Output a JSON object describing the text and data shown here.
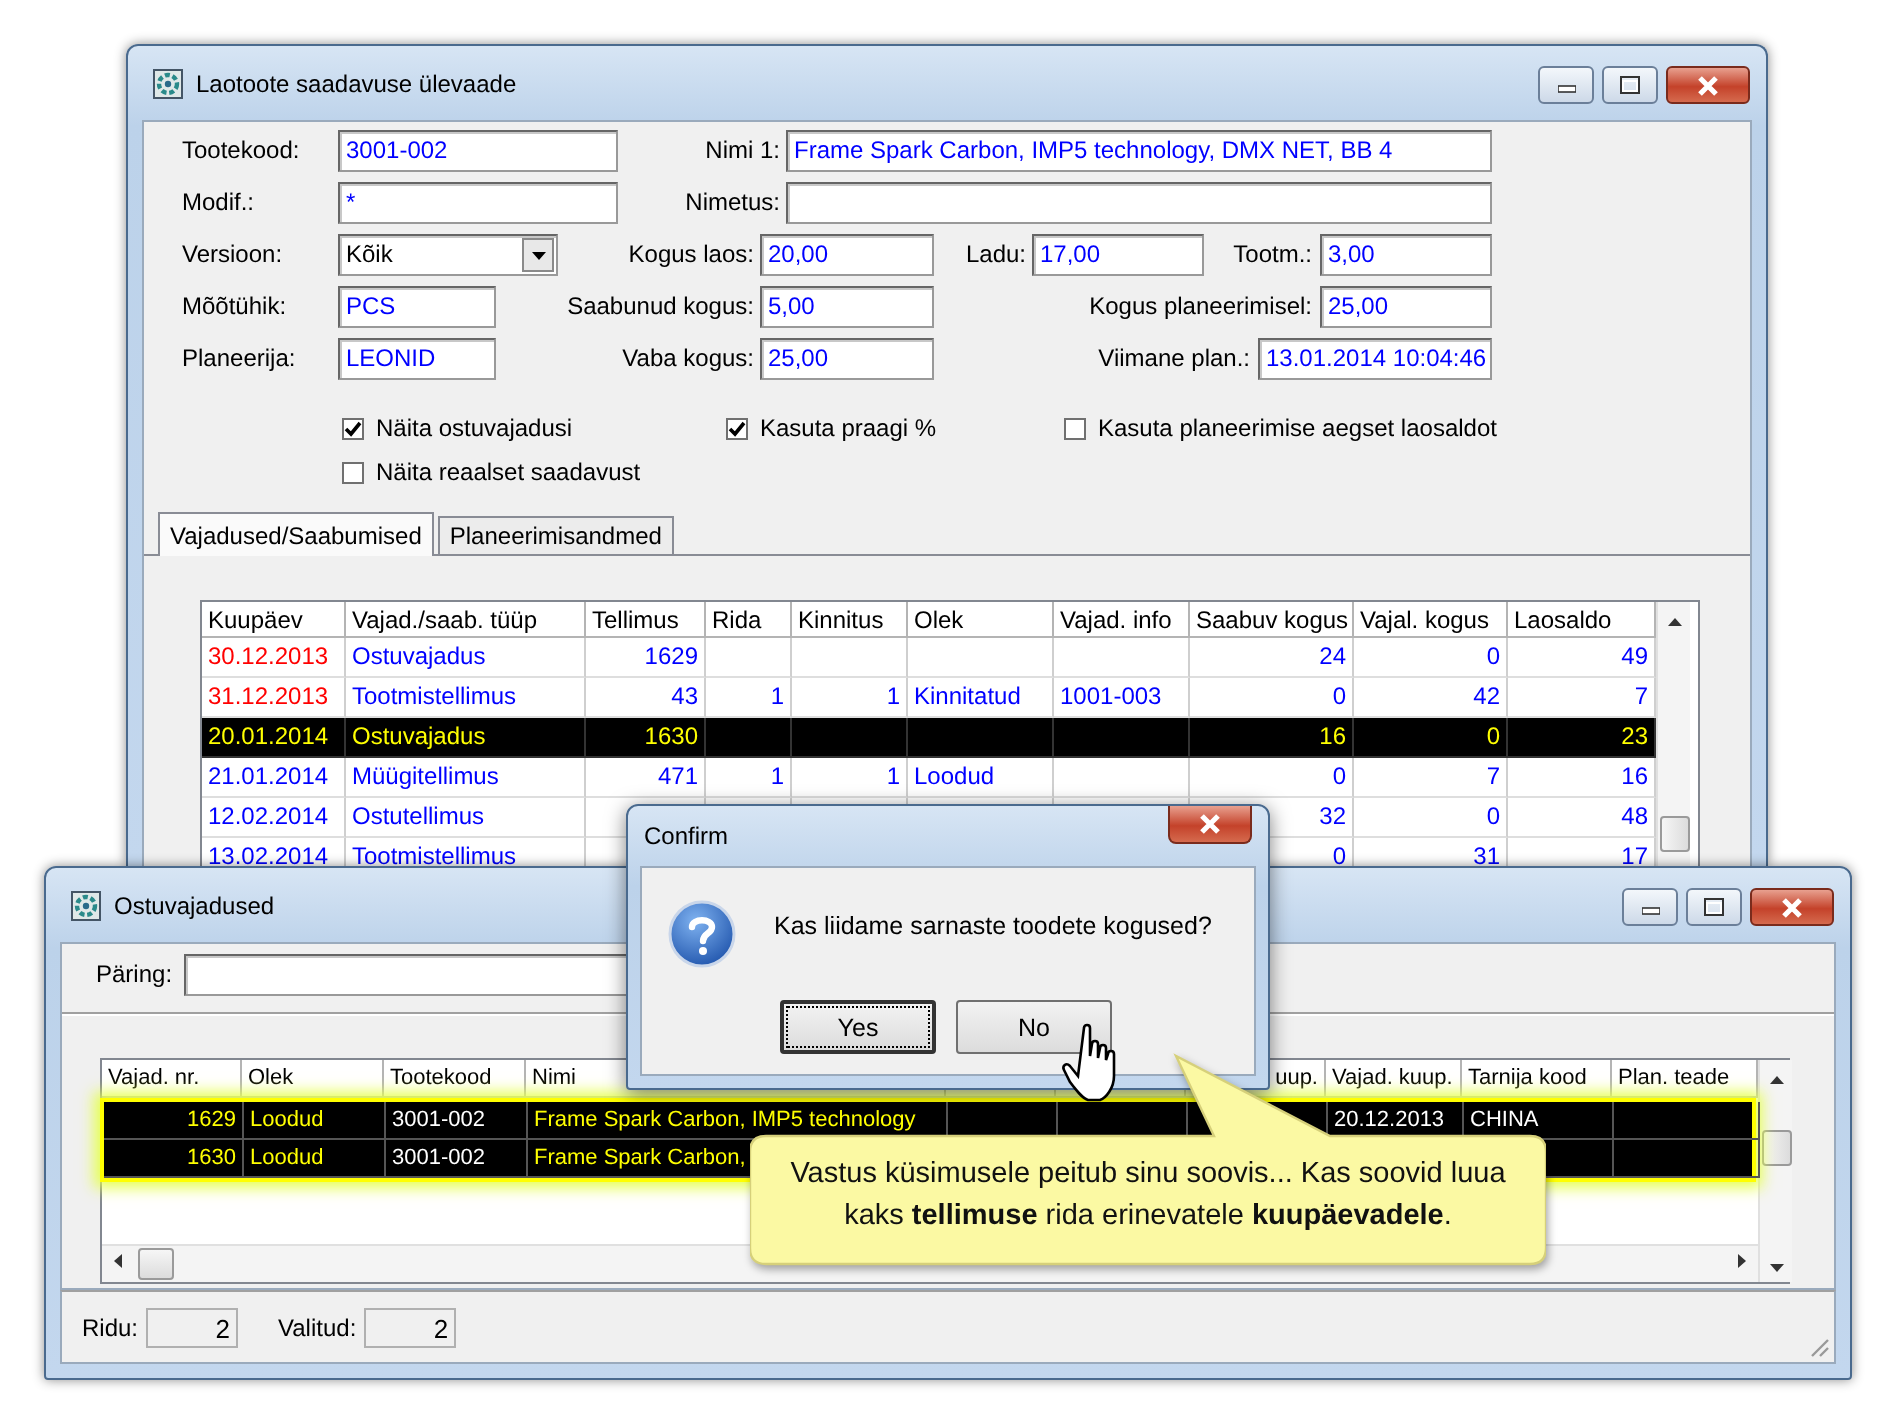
{
  "main_window": {
    "title": "Laotoote saadavuse ülevaade",
    "form_rows": [
      [
        {
          "kind": "label",
          "text": "Tootekood:"
        },
        {
          "kind": "field",
          "value": "3001-002"
        },
        {
          "kind": "label",
          "text": "Nimi 1:"
        },
        {
          "kind": "field",
          "value": "Frame Spark Carbon, IMP5 technology, DMX NET, BB 4"
        }
      ],
      [
        {
          "kind": "label",
          "text": "Modif.:"
        },
        {
          "kind": "field",
          "value": "*"
        },
        {
          "kind": "label",
          "text": "Nimetus:"
        },
        {
          "kind": "field"
        }
      ],
      [
        {
          "kind": "label",
          "text": "Versioon:"
        },
        {
          "kind": "select",
          "value": "Kõik"
        },
        {
          "kind": "label",
          "text": "Kogus laos:"
        },
        {
          "kind": "field",
          "value": "20,00"
        },
        {
          "kind": "label",
          "text": "Ladu:"
        },
        {
          "kind": "field",
          "value": "17,00"
        },
        {
          "kind": "label",
          "text": "Tootm.:"
        },
        {
          "kind": "field",
          "value": "3,00"
        }
      ],
      [
        {
          "kind": "label",
          "text": "Mõõtühik:"
        },
        {
          "kind": "field",
          "value": "PCS"
        },
        {
          "kind": "label",
          "text": "Saabunud kogus:"
        },
        {
          "kind": "field",
          "value": "5,00"
        },
        {
          "kind": "label",
          "text": "Kogus planeerimisel:"
        },
        {
          "kind": "field",
          "value": "25,00"
        }
      ],
      [
        {
          "kind": "label",
          "text": "Planeerija:"
        },
        {
          "kind": "field",
          "value": "LEONID"
        },
        {
          "kind": "label",
          "text": "Vaba kogus:"
        },
        {
          "kind": "field",
          "value": "25,00"
        },
        {
          "kind": "label",
          "text": "Viimane plan.:"
        },
        {
          "kind": "field",
          "value": "13.01.2014 10:04:46"
        }
      ]
    ],
    "checkboxes": [
      {
        "label": "Näita ostuvajadusi",
        "checked": true
      },
      {
        "label": "Kasuta praagi %",
        "checked": true
      },
      {
        "label": "Kasuta planeerimise aegset laosaldot",
        "checked": false
      },
      {
        "label": "Näita reaalset saadavust",
        "checked": false
      }
    ],
    "tabs": [
      {
        "label": "Vajadused/Saabumised",
        "selected": true
      },
      {
        "label": "Planeerimisandmed",
        "selected": false
      }
    ],
    "table": {
      "columns": [
        "Kuupäev",
        "Vajad./saab. tüüp",
        "Tellimus",
        "Rida",
        "Kinnitus",
        "Olek",
        "Vajad. info",
        "Saabuv kogus",
        "Vajal. kogus",
        "Laosaldo"
      ],
      "rows": [
        {
          "late": true,
          "selected": false,
          "cells": [
            "30.12.2013",
            "Ostuvajadus",
            "1629",
            null,
            null,
            null,
            null,
            "24",
            "0",
            "49"
          ]
        },
        {
          "late": true,
          "selected": false,
          "cells": [
            "31.12.2013",
            "Tootmistellimus",
            "43",
            "1",
            "1",
            "Kinnitatud",
            "1001-003",
            "0",
            "42",
            "7"
          ]
        },
        {
          "late": false,
          "selected": true,
          "cells": [
            "20.01.2014",
            "Ostuvajadus",
            "1630",
            null,
            null,
            null,
            null,
            "16",
            "0",
            "23"
          ]
        },
        {
          "late": false,
          "selected": false,
          "cells": [
            "21.01.2014",
            "Müügitellimus",
            "471",
            "1",
            "1",
            "Loodud",
            null,
            "0",
            "7",
            "16"
          ]
        },
        {
          "late": false,
          "selected": false,
          "cells": [
            "12.02.2014",
            "Ostutellimus",
            null,
            null,
            null,
            null,
            null,
            "32",
            "0",
            "48"
          ]
        },
        {
          "late": false,
          "selected": false,
          "cells": [
            "13.02.2014",
            "Tootmistellimus",
            null,
            null,
            null,
            null,
            null,
            "0",
            "31",
            "17"
          ]
        }
      ]
    }
  },
  "needs_window": {
    "title": "Ostuvajadused",
    "query_label": "Päring:",
    "table": {
      "columns": [
        "Vajad. nr.",
        "Olek",
        "Tootekood",
        "Nimi",
        null,
        null,
        "uup.",
        "Vajad. kuup.",
        "Tarnija kood",
        "Plan. teade"
      ],
      "rows": [
        {
          "selected": true,
          "cells": [
            "1629",
            "Loodud",
            "3001-002",
            "Frame Spark Carbon, IMP5 technology",
            null,
            null,
            null,
            "20.12.2013",
            "CHINA",
            null
          ]
        },
        {
          "selected": true,
          "cells": [
            "1630",
            "Loodud",
            "3001-002",
            "Frame Spark Carbon,",
            null,
            null,
            null,
            null,
            null,
            null
          ]
        }
      ]
    },
    "status": [
      {
        "label": "Ridu:",
        "value": "2"
      },
      {
        "label": "Valitud:",
        "value": "2"
      }
    ]
  },
  "dialog": {
    "title": "Confirm",
    "message": "Kas liidame sarnaste toodete kogused?",
    "buttons": [
      {
        "label": "Yes",
        "focused": true
      },
      {
        "label": "No",
        "focused": false
      }
    ]
  },
  "callout": {
    "text": "Vastus küsimusele peitub sinu soovis... Kas soovid luua kaks **tellimuse** rida erinevatele **kuupäevadele**."
  }
}
